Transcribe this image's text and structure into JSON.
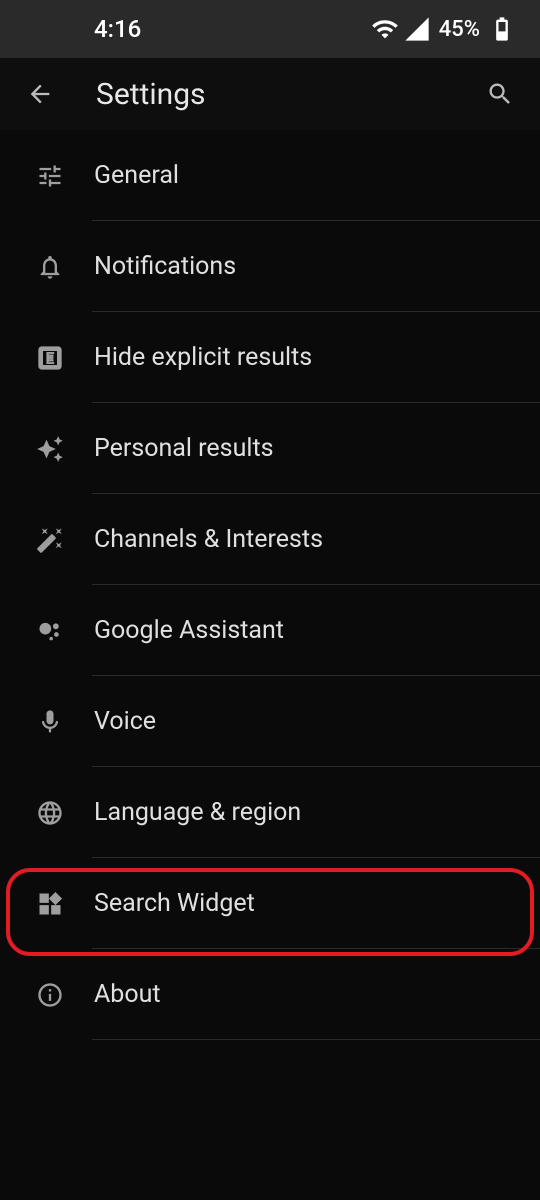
{
  "statusBar": {
    "time": "4:16",
    "battery": "45%"
  },
  "appBar": {
    "title": "Settings"
  },
  "items": [
    {
      "label": "General",
      "icon": "tune"
    },
    {
      "label": "Notifications",
      "icon": "bell"
    },
    {
      "label": "Hide explicit results",
      "icon": "explicit"
    },
    {
      "label": "Personal results",
      "icon": "sparkle"
    },
    {
      "label": "Channels & Interests",
      "icon": "wand"
    },
    {
      "label": "Google Assistant",
      "icon": "assistant"
    },
    {
      "label": "Voice",
      "icon": "mic"
    },
    {
      "label": "Language & region",
      "icon": "globe"
    },
    {
      "label": "Search Widget",
      "icon": "widgets"
    },
    {
      "label": "About",
      "icon": "info"
    }
  ],
  "highlightedIndex": 8
}
